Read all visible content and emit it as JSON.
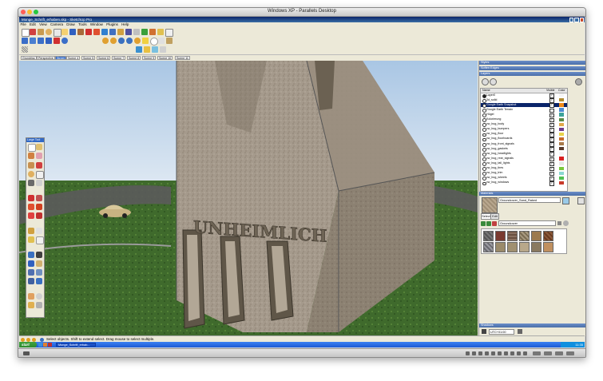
{
  "host_window": {
    "title": "Windows XP - Parallels Desktop"
  },
  "app": {
    "title": "Monge_Schrift_erhaben.skp - SketchUp Pro",
    "menu": [
      "File",
      "Edit",
      "View",
      "Camera",
      "Draw",
      "Tools",
      "Window",
      "Plugins",
      "Help"
    ]
  },
  "scenes": [
    "Grundriss",
    "Perspective",
    "Street",
    "Scene 4",
    "Scene 5",
    "Scene 6",
    "Scene 7",
    "Scene 8",
    "Scene 9",
    "Scene 10",
    "Scene 11"
  ],
  "active_scene": "Street",
  "large_tools": {
    "title": "Large Tool Set"
  },
  "model_text": "UNHEIMLICH",
  "panels": {
    "styles": "Styles",
    "soften": "Soften Edges",
    "layers": "Layers",
    "materials": "Materials",
    "shadows": "Shadows"
  },
  "layers": {
    "headers": {
      "name": "Name",
      "visible": "Visible",
      "color": "Color"
    },
    "rows": [
      {
        "name": "Layer0",
        "visible": true,
        "color": "#f5f5f5",
        "selected": false,
        "active": true
      },
      {
        "name": "3d_solid",
        "visible": true,
        "color": "#b08a2e",
        "selected": false
      },
      {
        "name": "Google Earth Snapshot",
        "visible": true,
        "color": "#f08a1a",
        "selected": true
      },
      {
        "name": "Google Earth Terrain",
        "visible": false,
        "color": "#4c8ad0",
        "selected": false
      },
      {
        "name": "Hügel",
        "visible": true,
        "color": "#3da39a",
        "selected": false
      },
      {
        "name": "Kolorierung",
        "visible": true,
        "color": "#5a8a46",
        "selected": false
      },
      {
        "name": "vw_bug_body",
        "visible": true,
        "color": "#e0a84a",
        "selected": false
      },
      {
        "name": "vw_bug_bumpers",
        "visible": true,
        "color": "#6e3a8a",
        "selected": false
      },
      {
        "name": "vw_bug_floor",
        "visible": true,
        "color": "#e8d24a",
        "selected": false
      },
      {
        "name": "vw_bug_floorboards",
        "visible": true,
        "color": "#c86a2a",
        "selected": false
      },
      {
        "name": "vw_bug_front_signals",
        "visible": true,
        "color": "#a87a4a",
        "selected": false
      },
      {
        "name": "vw_bug_gaskets",
        "visible": true,
        "color": "#5a3a2a",
        "selected": false
      },
      {
        "name": "vw_bug_headlights",
        "visible": true,
        "color": "#f4f4f4",
        "selected": false
      },
      {
        "name": "vw_bug_rear_signals",
        "visible": true,
        "color": "#d82020",
        "selected": false
      },
      {
        "name": "vw_bug_tail_lights",
        "visible": true,
        "color": "#e8e8e8",
        "selected": false
      },
      {
        "name": "vw_bug_tires",
        "visible": true,
        "color": "#7ac83a",
        "selected": false
      },
      {
        "name": "vw_bug_trim",
        "visible": true,
        "color": "#8ad8d0",
        "selected": false
      },
      {
        "name": "vw_bug_wheels",
        "visible": true,
        "color": "#50c050",
        "selected": false
      },
      {
        "name": "vw_bug_windows",
        "visible": true,
        "color": "#c83a2a",
        "selected": false
      }
    ]
  },
  "materials": {
    "current": "Groundcover_Sand_Raked",
    "tabs": [
      "Select",
      "Edit"
    ],
    "library": "Groundcover"
  },
  "shadows": {
    "timezone": "UTC+01:00"
  },
  "status": {
    "text": "Select objects. Shift to extend select. Drag mouse to select multiple."
  },
  "taskbar": {
    "start": "start",
    "task": "Monge_Schrift_erhab...",
    "clock": "11:35"
  }
}
